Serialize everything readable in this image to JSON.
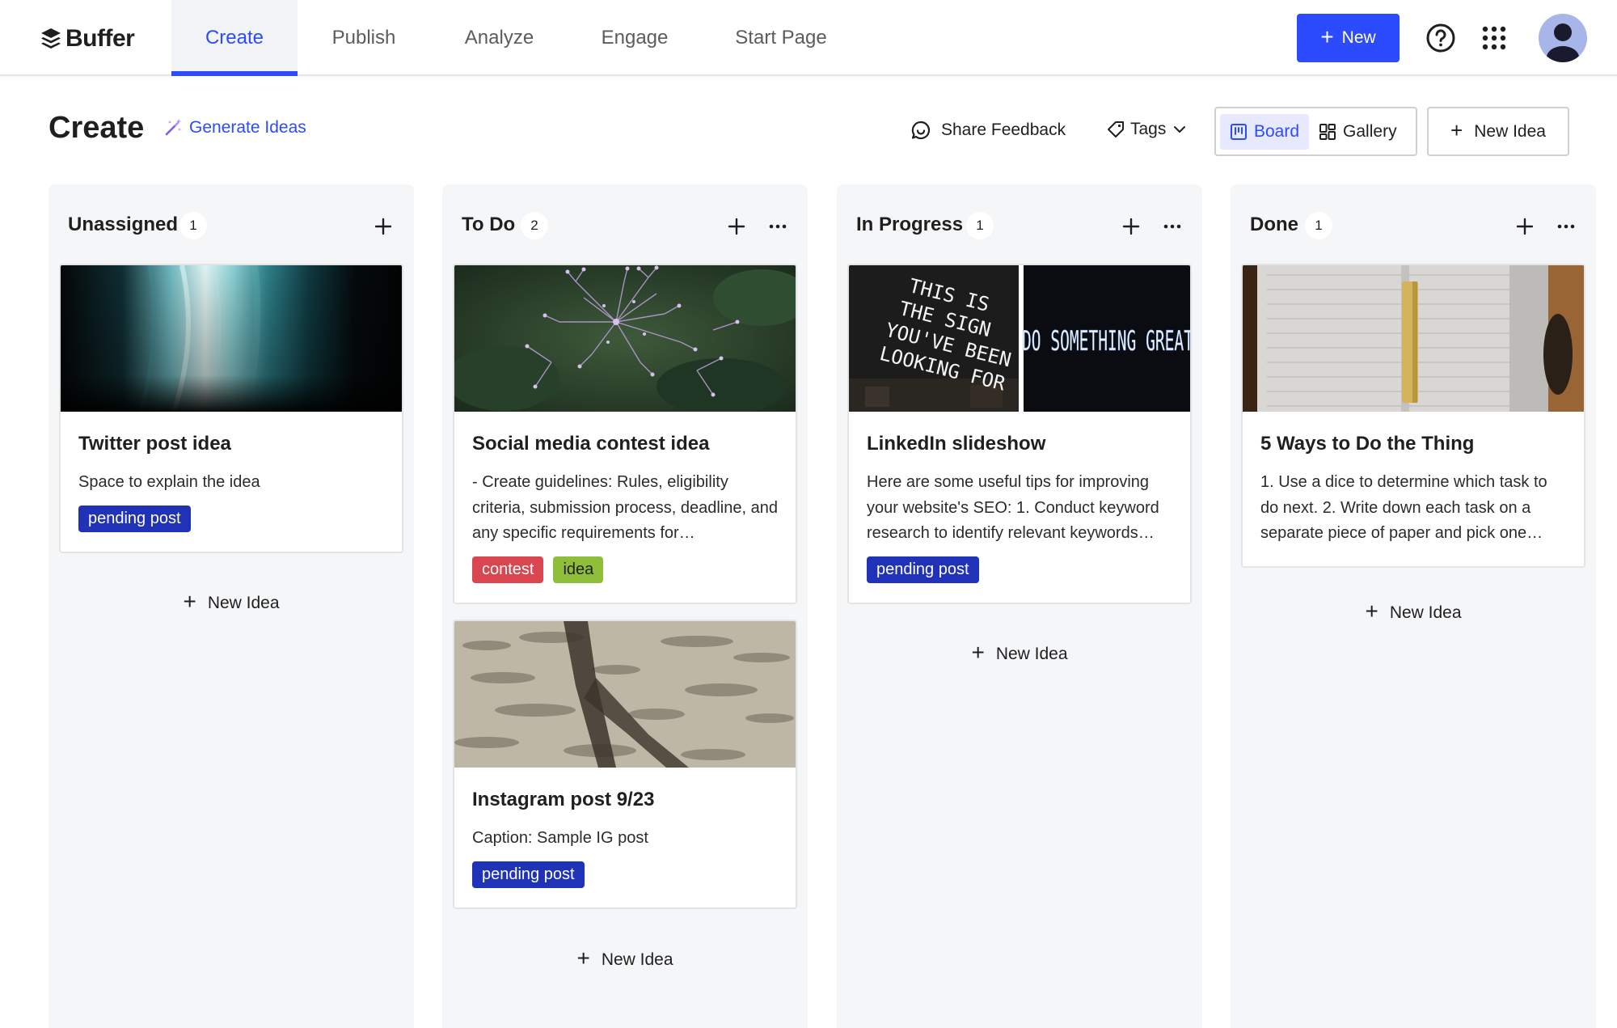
{
  "app": {
    "brand": "Buffer"
  },
  "nav": {
    "tabs": [
      {
        "label": "Create",
        "active": true
      },
      {
        "label": "Publish",
        "active": false
      },
      {
        "label": "Analyze",
        "active": false
      },
      {
        "label": "Engage",
        "active": false
      },
      {
        "label": "Start Page",
        "active": false
      }
    ],
    "new_label": "New",
    "icons": [
      "help-icon",
      "apps-grid-icon",
      "avatar"
    ]
  },
  "header": {
    "title": "Create",
    "generate_ideas": "Generate Ideas",
    "share_feedback": "Share Feedback",
    "tags": "Tags",
    "view_board": "Board",
    "view_gallery": "Gallery",
    "new_idea": "New Idea"
  },
  "colors": {
    "accent": "#2c4bff",
    "pending_tag": "#2033b8",
    "contest_tag": "#d94650",
    "idea_tag": "#8fbf3a",
    "column_bg": "#f5f6f8"
  },
  "columns": [
    {
      "title": "Unassigned",
      "count": "1",
      "new_idea": "New Idea",
      "cards": [
        {
          "title": "Twitter post idea",
          "text": "Space to explain the idea",
          "tags": [
            "pending post"
          ],
          "image": "teal-light-streaks"
        }
      ]
    },
    {
      "title": "To Do",
      "count": "2",
      "new_idea": "New Idea",
      "cards": [
        {
          "title": "Social media contest idea",
          "text": "- Create guidelines: Rules, eligibility criteria, submission process, deadline, and any specific requirements for…",
          "tags": [
            "contest",
            "idea"
          ],
          "image": "purple-flowers"
        },
        {
          "title": "Instagram post 9/23",
          "text": "Caption: Sample IG post",
          "tags": [
            "pending post"
          ],
          "image": "sand-shadow"
        }
      ]
    },
    {
      "title": "In Progress",
      "count": "1",
      "new_idea": "New Idea",
      "cards": [
        {
          "title": "LinkedIn slideshow",
          "text": "Here are some useful tips for improving your website's SEO: 1. Conduct keyword research to identify relevant keywords…",
          "tags": [
            "pending post"
          ],
          "image": "neon-signs"
        }
      ]
    },
    {
      "title": "Done",
      "count": "1",
      "new_idea": "New Idea",
      "cards": [
        {
          "title": "5 Ways to Do the Thing",
          "text": "1. Use a dice to determine which task to do next. 2. Write down each task on a separate piece of paper and pick one…",
          "tags": [],
          "image": "notebook-pencil"
        }
      ]
    }
  ],
  "neon": {
    "left_lines": [
      "THIS IS",
      "THE SIGN",
      "YOU'VE BEEN",
      "LOOKING FOR"
    ],
    "right_text": "DO SOMETHING GREAT"
  }
}
